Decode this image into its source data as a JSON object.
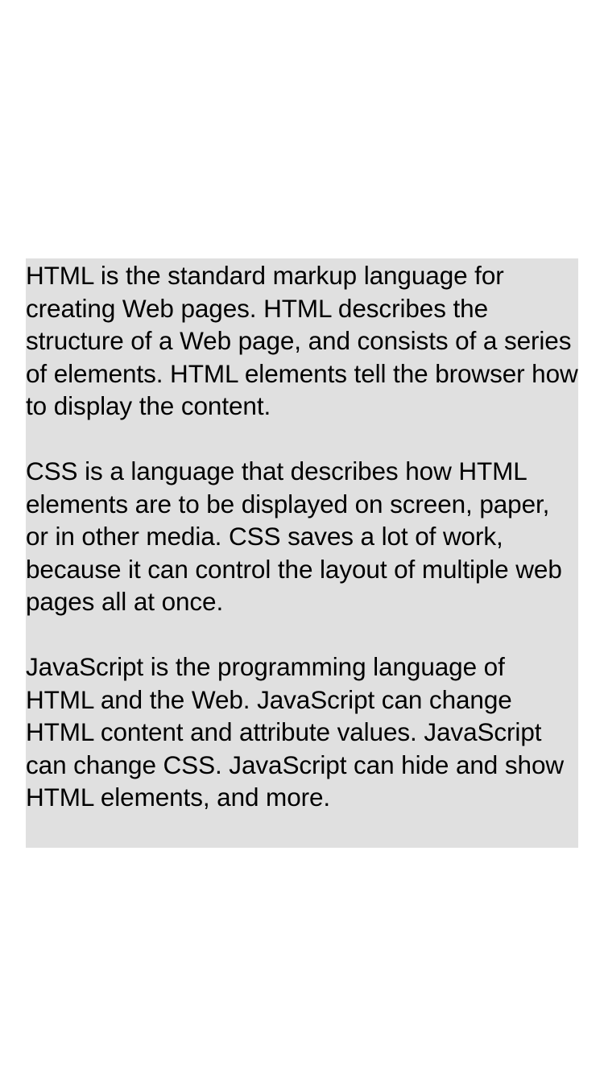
{
  "page": {
    "background_color": "#ffffff",
    "box_color": "#e0e0e0",
    "text_color": "#000000"
  },
  "content": {
    "paragraphs": [
      "HTML is the standard markup language for creating Web pages. HTML describes the structure of a Web page, and consists of a series of elements. HTML elements tell the browser how to display the content.",
      "CSS is a language that describes how HTML elements are to be displayed on screen, paper, or in other media. CSS saves a lot of work, because it can control the layout of multiple web pages all at once.",
      "JavaScript is the programming language of HTML and the Web. JavaScript can change HTML content and attribute values. JavaScript can change CSS. JavaScript can hide and show HTML elements, and more."
    ]
  }
}
